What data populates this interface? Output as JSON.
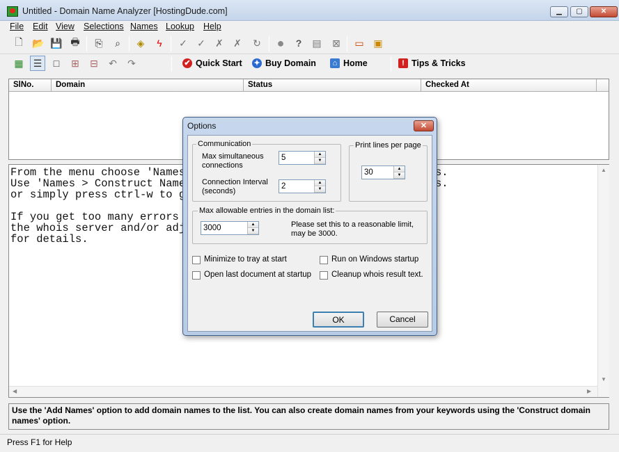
{
  "window": {
    "title": "Untitled - Domain Name Analyzer [HostingDude.com]",
    "min_label": "▁",
    "max_label": "▢",
    "close_label": "✕"
  },
  "menu": [
    "File",
    "Edit",
    "View",
    "Selections",
    "Names",
    "Lookup",
    "Help"
  ],
  "toolbar2": {
    "quick_start": "Quick Start",
    "buy_domain": "Buy Domain",
    "home": "Home",
    "tips": "Tips & Tricks"
  },
  "columns": [
    "SlNo.",
    "Domain",
    "Status",
    "Checked At"
  ],
  "text_panel": [
    "From the menu choose 'Names",
    "Use 'Names > Construct Names",
    "or simply press ctrl-w to ge",
    "",
    "If you get too many errors o",
    "the whois server and/or adju",
    "for details."
  ],
  "text_panel_right": [
    "s.",
    "s."
  ],
  "hint": "Use the 'Add Names' option to add domain names to the list. You can also create domain names from your keywords using the 'Construct domain names' option.",
  "status": "Press F1 for Help",
  "dialog": {
    "title": "Options",
    "close_label": "✕",
    "communication": {
      "title": "Communication",
      "max_label_1": "Max simultaneous",
      "max_label_2": "connections",
      "max_value": "5",
      "interval_label_1": "Connection Interval",
      "interval_label_2": "(seconds)",
      "interval_value": "2"
    },
    "print": {
      "title": "Print lines per page",
      "value": "30"
    },
    "entries": {
      "title": "Max allowable entries in the domain list:",
      "value": "3000",
      "note": "Please set this to a reasonable limit, may be 3000."
    },
    "checkboxes": [
      "Minimize to tray at start",
      "Run on Windows startup",
      "Open last document at startup",
      "Cleanup whois result text."
    ],
    "ok": "OK",
    "cancel": "Cancel"
  }
}
